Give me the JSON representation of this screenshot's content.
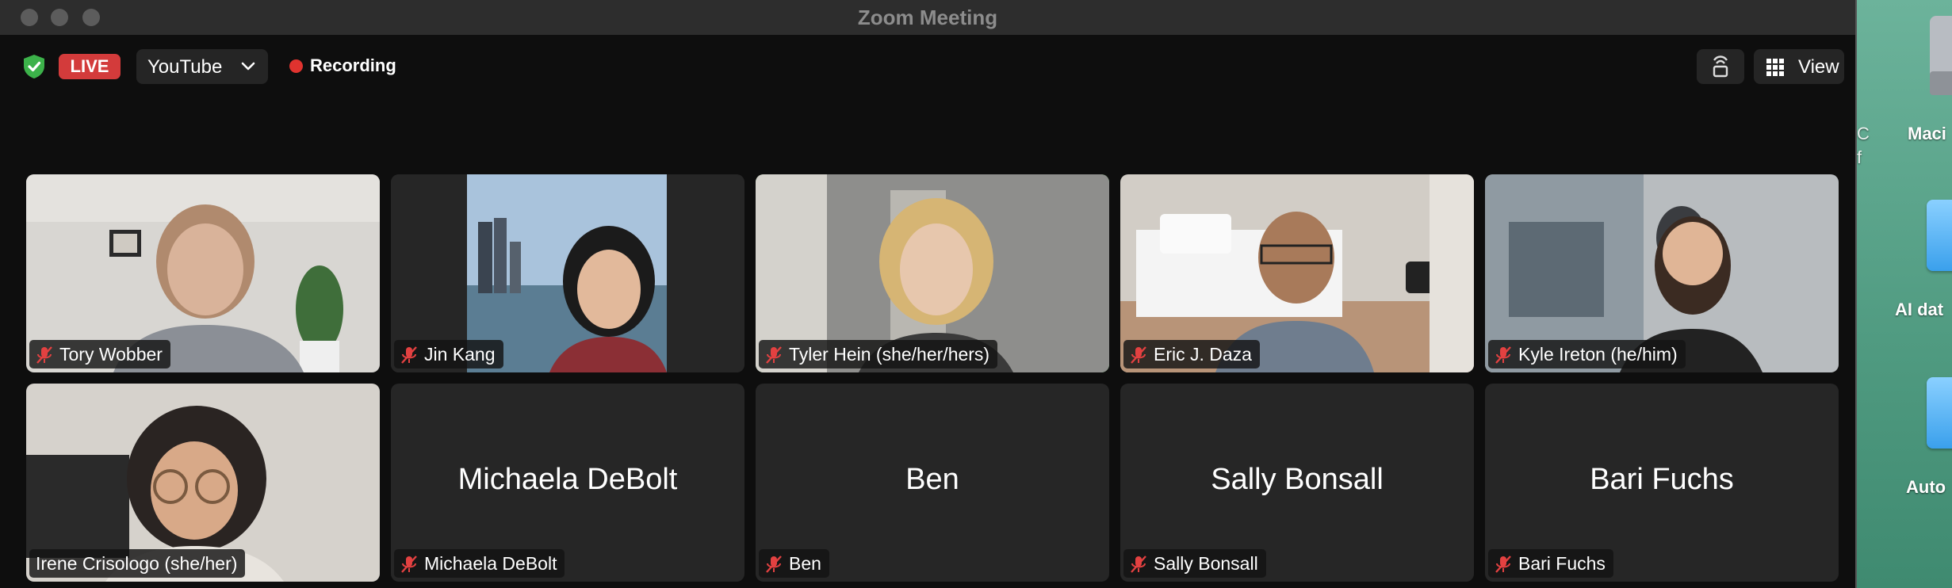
{
  "window": {
    "title": "Zoom Meeting"
  },
  "meeting_bar": {
    "live_label": "LIVE",
    "stream_target": "YouTube",
    "recording_label": "Recording",
    "view_label": "View"
  },
  "colors": {
    "live": "#d33b3b",
    "recording": "#e0332f",
    "active_speaker_border": "#5ad35a",
    "shield": "#3cb24a"
  },
  "participants": [
    {
      "name": "Tory Wobber",
      "muted": true,
      "video": true
    },
    {
      "name": "Jin Kang",
      "muted": true,
      "video": true
    },
    {
      "name": "Tyler Hein (she/her/hers)",
      "muted": true,
      "video": true,
      "active_speaker": true
    },
    {
      "name": "Eric J. Daza",
      "muted": true,
      "video": true
    },
    {
      "name": "Kyle Ireton (he/him)",
      "muted": true,
      "video": true
    },
    {
      "name": "Irene Crisologo (she/her)",
      "muted": false,
      "video": true
    },
    {
      "name": "Michaela DeBolt",
      "display_name": "Michaela DeBolt",
      "muted": true,
      "video": false
    },
    {
      "name": "Ben",
      "display_name": "Ben",
      "muted": true,
      "video": false
    },
    {
      "name": "Sally Bonsall",
      "display_name": "Sally Bonsall",
      "muted": true,
      "video": false
    },
    {
      "name": "Bari Fuchs",
      "display_name": "Bari Fuchs",
      "muted": true,
      "video": false
    }
  ],
  "desktop": {
    "icons": [
      {
        "label": "Maci",
        "icon": "hard-drive-icon"
      },
      {
        "label": "AI dat",
        "icon": "folder-icon"
      },
      {
        "label": "Auto",
        "icon": "folder-icon"
      }
    ],
    "partial_text": [
      "C",
      "f"
    ]
  }
}
